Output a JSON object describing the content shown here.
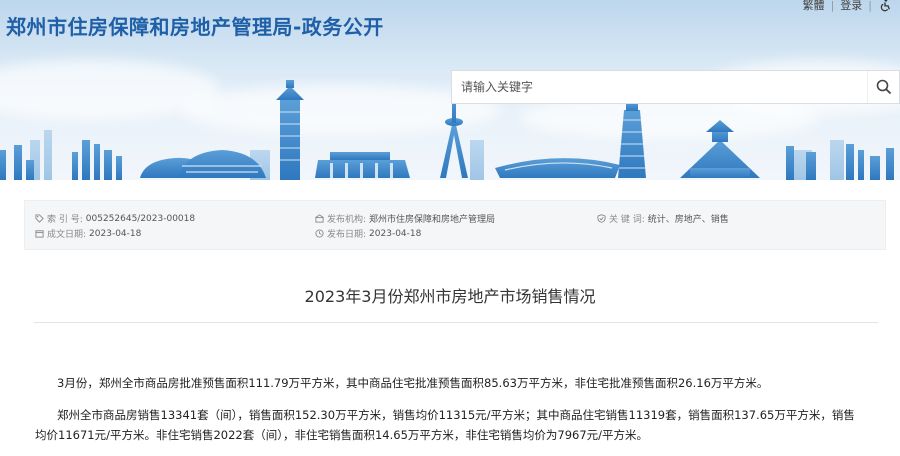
{
  "header": {
    "site_title": "郑州市住房保障和房地产管理局-政务公开",
    "top_links": {
      "traditional": "繁體",
      "login": "登录",
      "separator": "|"
    },
    "search": {
      "placeholder": "请输入关键字",
      "icon": "search-icon"
    },
    "colors": {
      "title": "#1f5fa8",
      "sky": "#d8e8f5",
      "skyline": "#3f87c7"
    }
  },
  "meta": {
    "index_no": {
      "label": "索 引 号:",
      "value": "005252645/2023-00018",
      "icon": "tag-icon"
    },
    "issuer": {
      "label": "发布机构:",
      "value": "郑州市住房保障和房地产管理局",
      "icon": "building-icon"
    },
    "keywords": {
      "label": "关 键 词:",
      "value": "统计、房地产、销售",
      "icon": "shield-check-icon"
    },
    "created": {
      "label": "成文日期:",
      "value": "2023-04-18",
      "icon": "calendar-icon"
    },
    "published": {
      "label": "发布日期:",
      "value": "2023-04-18",
      "icon": "clock-icon"
    }
  },
  "article": {
    "title": "2023年3月份郑州市房地产市场销售情况",
    "paragraphs": [
      "3月份，郑州全市商品房批准预售面积111.79万平方米，其中商品住宅批准预售面积85.63万平方米，非住宅批准预售面积26.16万平方米。",
      "郑州全市商品房销售13341套（间），销售面积152.30万平方米，销售均价11315元/平方米；其中商品住宅销售11319套，销售面积137.65万平方米，销售",
      "均价11671元/平方米。非住宅销售2022套（间），非住宅销售面积14.65万平方米，非住宅销售均价为7967元/平方米。"
    ]
  }
}
